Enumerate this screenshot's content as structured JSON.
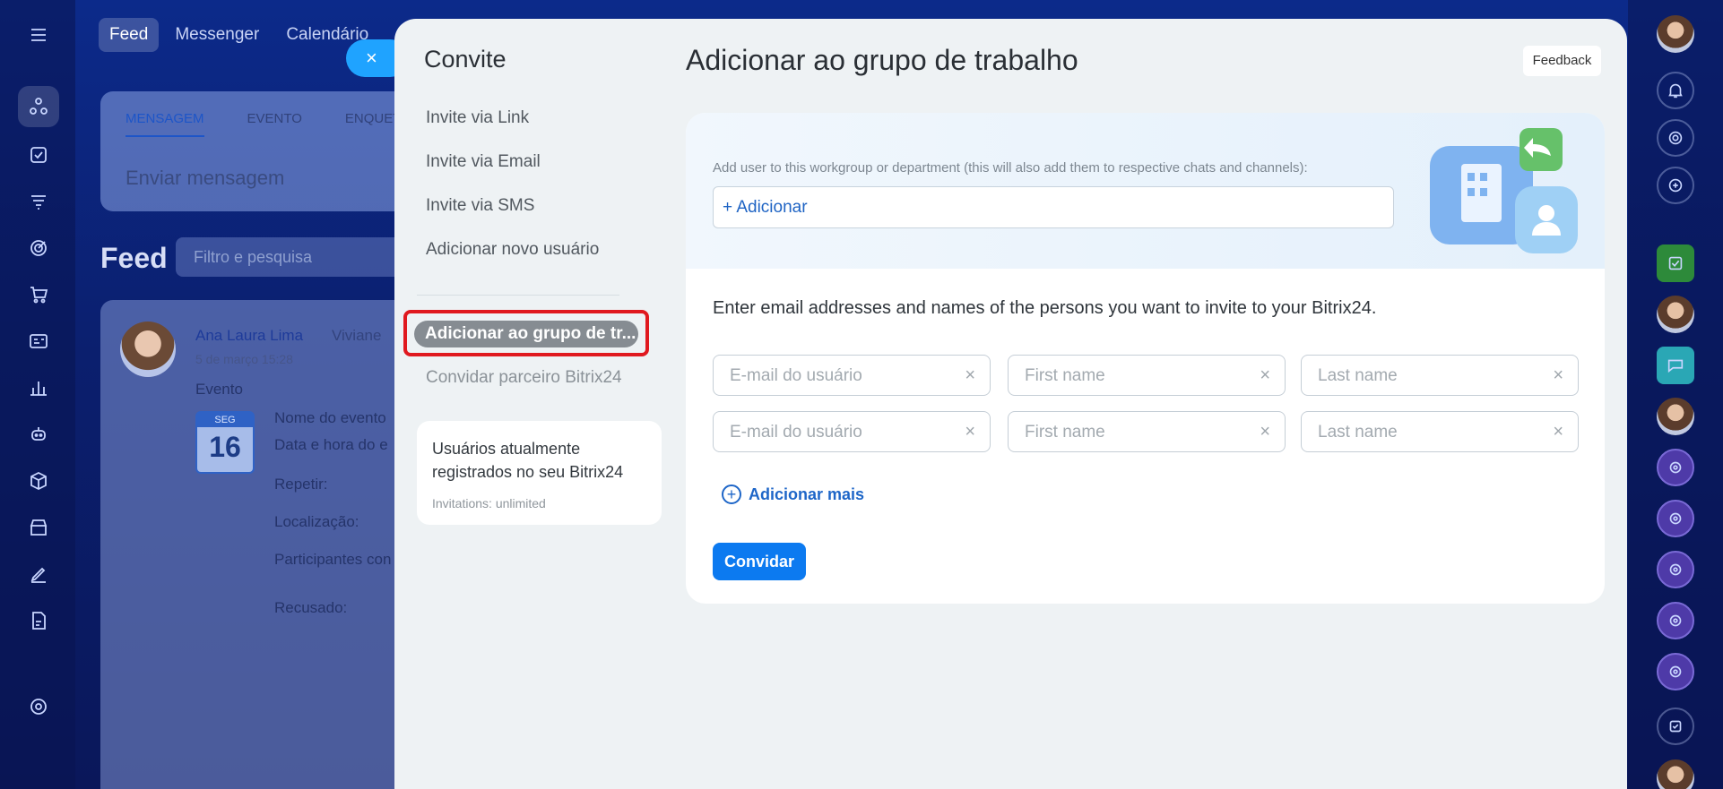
{
  "background": {
    "top_tabs": [
      "Feed",
      "Messenger",
      "Calendário"
    ],
    "composer": {
      "tabs": [
        "MENSAGEM",
        "EVENTO",
        "ENQUET"
      ],
      "placeholder": "Enviar mensagem"
    },
    "feed": {
      "title": "Feed",
      "filter_placeholder": "Filtro e pesquisa"
    },
    "post": {
      "author": "Ana Laura Lima",
      "recipient": "Viviane",
      "date": "5 de março 15:28",
      "type": "Evento",
      "calendar_day": "SEG",
      "calendar_number": "16",
      "fields": [
        "Nome do evento",
        "Data e hora do e",
        "Repetir:",
        "Localização:",
        "Participantes con",
        "Recusado:"
      ]
    }
  },
  "modal": {
    "close_icon": "×",
    "left_panel": {
      "title": "Convite",
      "menu": [
        "Invite via Link",
        "Invite via Email",
        "Invite via SMS",
        "Adicionar novo usuário"
      ],
      "active_item": "Adicionar ao grupo de tr...",
      "partner_item": "Convidar parceiro Bitrix24",
      "card": {
        "title": "Usuários atualmente registrados no seu Bitrix24",
        "subtitle": "Invitations: unlimited"
      }
    },
    "main": {
      "title": "Adicionar ao grupo de trabalho",
      "feedback_label": "Feedback",
      "workgroup_label": "Add user to this workgroup or department (this will also add them to respective chats and channels):",
      "workgroup_input": "+ Adicionar",
      "invite_heading": "Enter email addresses and names of the persons you want to invite to your Bitrix24.",
      "fields": {
        "email_placeholder": "E-mail do usuário",
        "first_name_placeholder": "First name",
        "last_name_placeholder": "Last name",
        "clear_icon": "×"
      },
      "add_more_label": "Adicionar mais",
      "invite_button": "Convidar"
    }
  },
  "colors": {
    "accent": "#0c7af0",
    "highlight_outline": "#e0191f",
    "background": "#0a1d6b"
  }
}
